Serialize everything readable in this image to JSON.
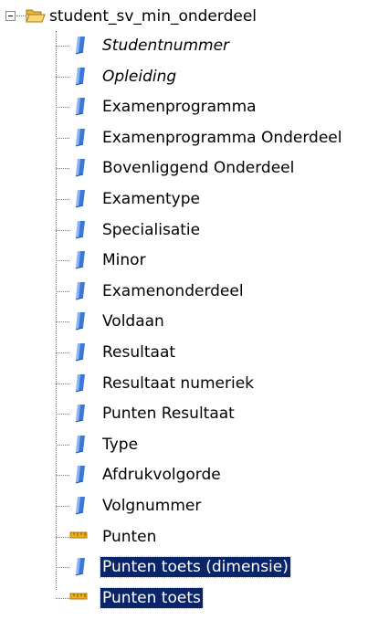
{
  "tree": {
    "root": {
      "label": "student_sv_min_onderdeel",
      "expander": "minus-box-icon",
      "icon": "open-folder-icon"
    },
    "items": [
      {
        "label": "Studentnummer",
        "icon": "attribute-icon",
        "italic": true,
        "selected": false
      },
      {
        "label": "Opleiding",
        "icon": "attribute-icon",
        "italic": true,
        "selected": false
      },
      {
        "label": "Examenprogramma",
        "icon": "attribute-icon",
        "italic": false,
        "selected": false
      },
      {
        "label": "Examenprogramma Onderdeel",
        "icon": "attribute-icon",
        "italic": false,
        "selected": false
      },
      {
        "label": "Bovenliggend Onderdeel",
        "icon": "attribute-icon",
        "italic": false,
        "selected": false
      },
      {
        "label": "Examentype",
        "icon": "attribute-icon",
        "italic": false,
        "selected": false
      },
      {
        "label": "Specialisatie",
        "icon": "attribute-icon",
        "italic": false,
        "selected": false
      },
      {
        "label": "Minor",
        "icon": "attribute-icon",
        "italic": false,
        "selected": false
      },
      {
        "label": "Examenonderdeel",
        "icon": "attribute-icon",
        "italic": false,
        "selected": false
      },
      {
        "label": "Voldaan",
        "icon": "attribute-icon",
        "italic": false,
        "selected": false
      },
      {
        "label": "Resultaat",
        "icon": "attribute-icon",
        "italic": false,
        "selected": false
      },
      {
        "label": "Resultaat numeriek",
        "icon": "attribute-icon",
        "italic": false,
        "selected": false
      },
      {
        "label": "Punten Resultaat",
        "icon": "attribute-icon",
        "italic": false,
        "selected": false
      },
      {
        "label": "Type",
        "icon": "attribute-icon",
        "italic": false,
        "selected": false
      },
      {
        "label": "Afdrukvolgorde",
        "icon": "attribute-icon",
        "italic": false,
        "selected": false
      },
      {
        "label": "Volgnummer",
        "icon": "attribute-icon",
        "italic": false,
        "selected": false
      },
      {
        "label": "Punten",
        "icon": "measure-icon",
        "italic": false,
        "selected": false
      },
      {
        "label": "Punten toets (dimensie)",
        "icon": "attribute-icon",
        "italic": false,
        "selected": true
      },
      {
        "label": "Punten toets",
        "icon": "measure-icon",
        "italic": false,
        "selected": true
      }
    ]
  },
  "colors": {
    "selection_background": "#0a246a",
    "selection_text": "#ffffff",
    "attribute_icon": "#3c78d8",
    "measure_icon": "#e8b020",
    "folder": "#f2c94c"
  }
}
